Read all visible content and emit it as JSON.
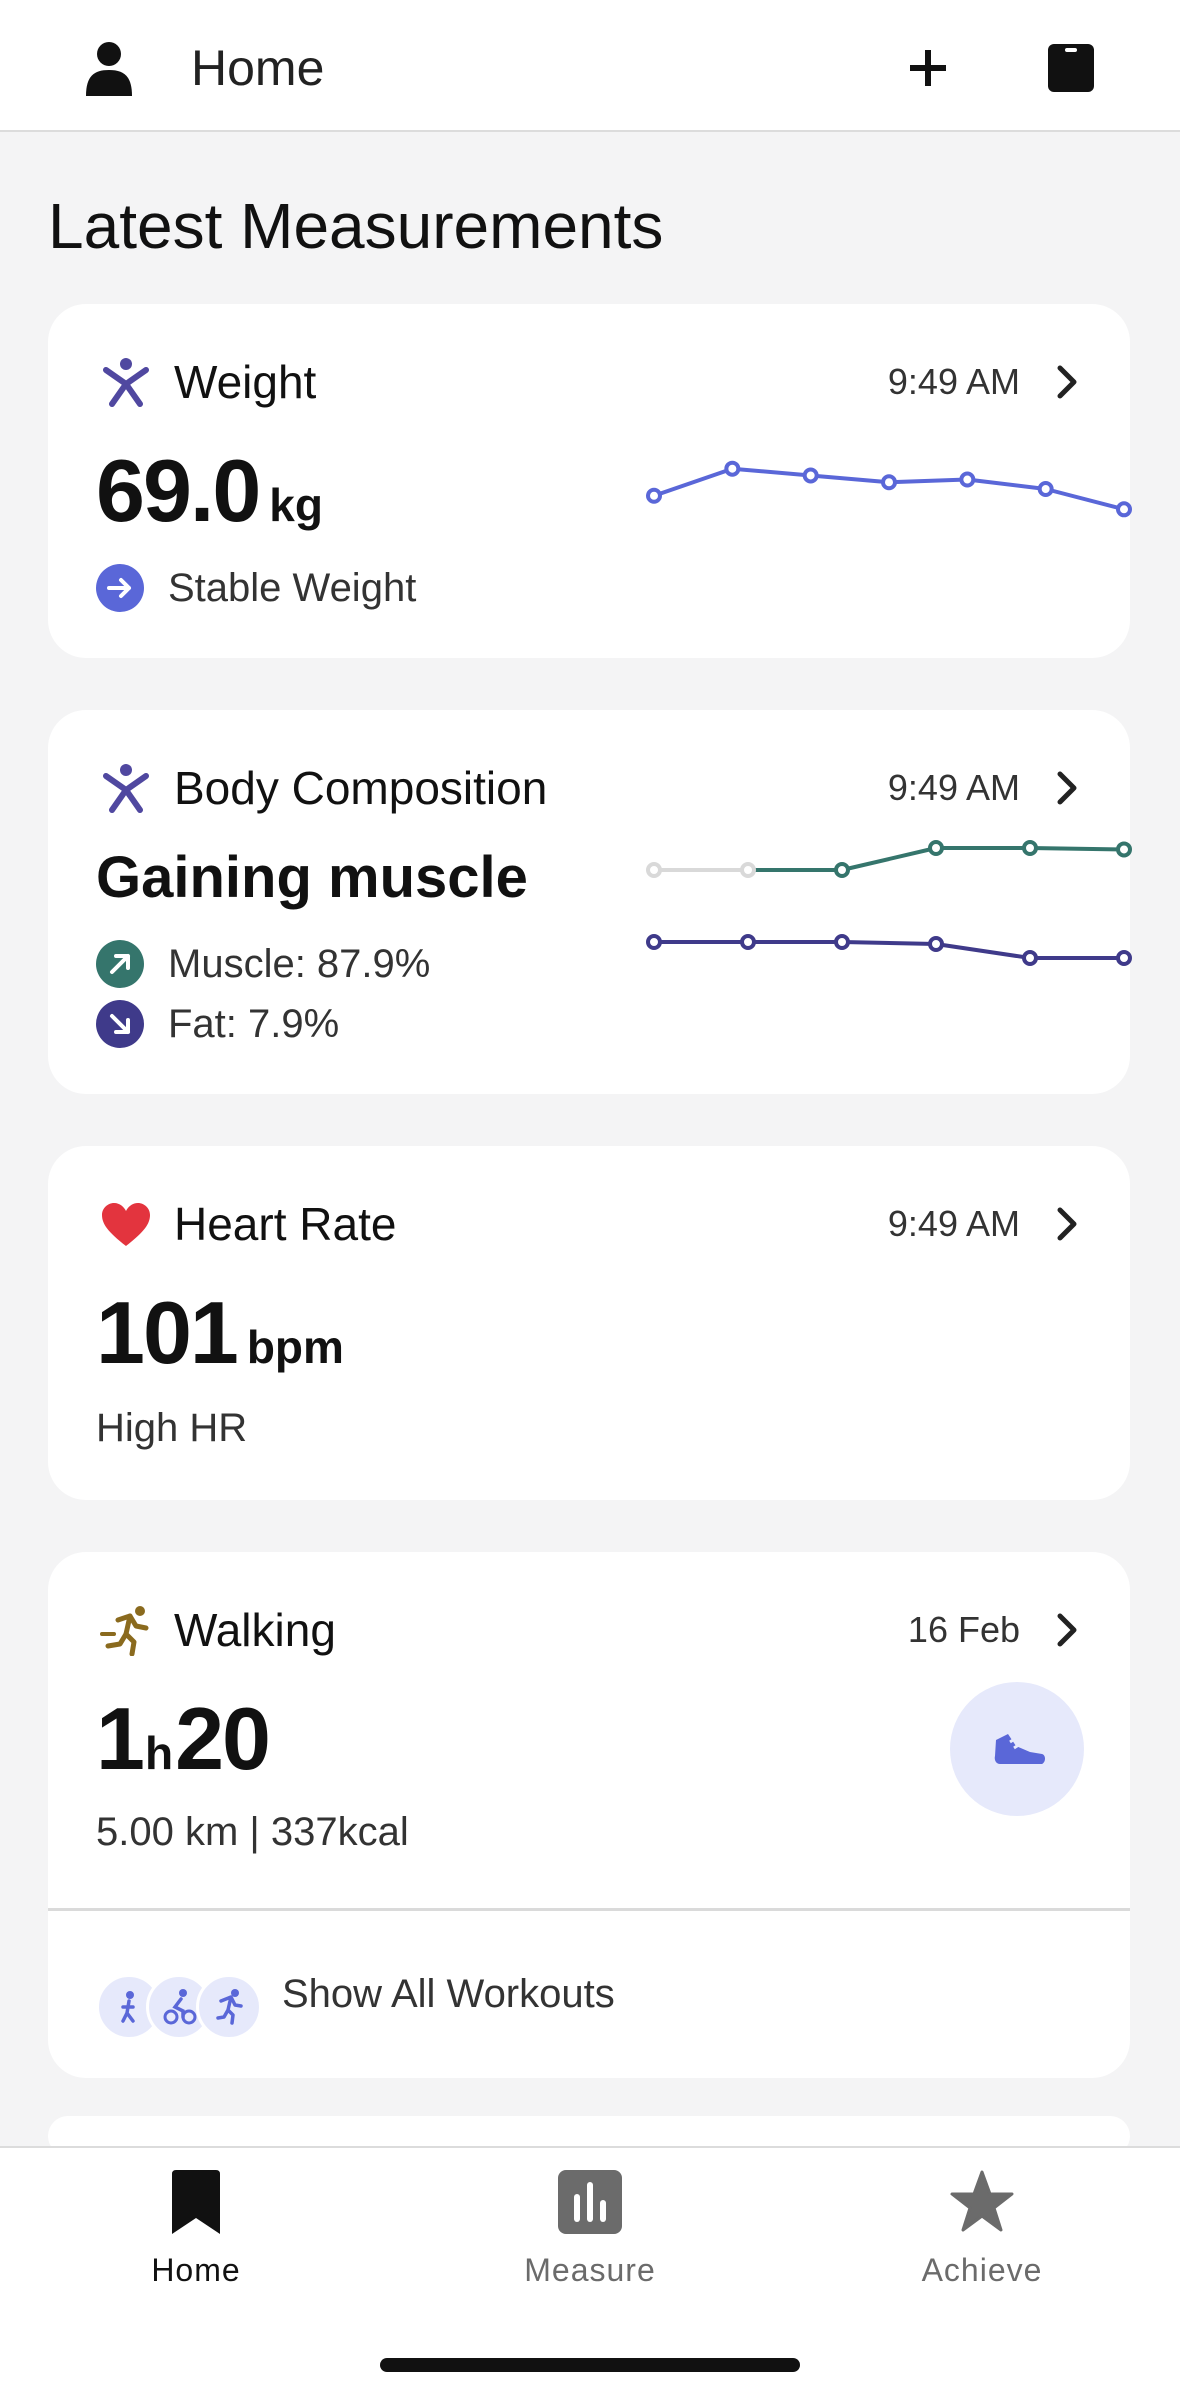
{
  "header": {
    "title": "Home",
    "icons": {
      "profile": "user-icon",
      "add": "plus-icon",
      "device": "tablet-icon"
    }
  },
  "section_title": "Latest Measurements",
  "weight_card": {
    "title": "Weight",
    "time": "9:49 AM",
    "value": "69.0",
    "unit": "kg",
    "status": "Stable Weight",
    "icon": "person-icon",
    "trend": [
      69.0,
      69.2,
      69.15,
      69.1,
      69.12,
      69.05,
      68.9
    ],
    "accent": "#5a67d8"
  },
  "body_card": {
    "title": "Body Composition",
    "time": "9:49 AM",
    "headline": "Gaining muscle",
    "muscle_label": "Muscle: 87.9%",
    "fat_label": "Fat: 7.9%",
    "icon": "person-icon",
    "muscle_trend": [
      0,
      0,
      0,
      0.3,
      0.3,
      0.28
    ],
    "fat_trend": [
      0,
      0,
      0,
      -0.01,
      -0.08,
      -0.08
    ],
    "muscle_color": "#35756c",
    "fat_color": "#3f3a8a",
    "inactive_color": "#d9d9d9"
  },
  "heart_card": {
    "title": "Heart Rate",
    "time": "9:49 AM",
    "value": "101",
    "unit": "bpm",
    "status": "High HR",
    "icon": "heart-icon",
    "accent": "#e3343e"
  },
  "walking_card": {
    "title": "Walking",
    "date": "16 Feb",
    "duration_h": "1",
    "duration_h_unit": "h",
    "duration_m": "20",
    "details": "5.00 km | 337kcal",
    "icon": "running-icon",
    "accent": "#8a6a1e",
    "show_all": "Show All Workouts"
  },
  "nav": {
    "home": "Home",
    "measure": "Measure",
    "achieve": "Achieve"
  }
}
